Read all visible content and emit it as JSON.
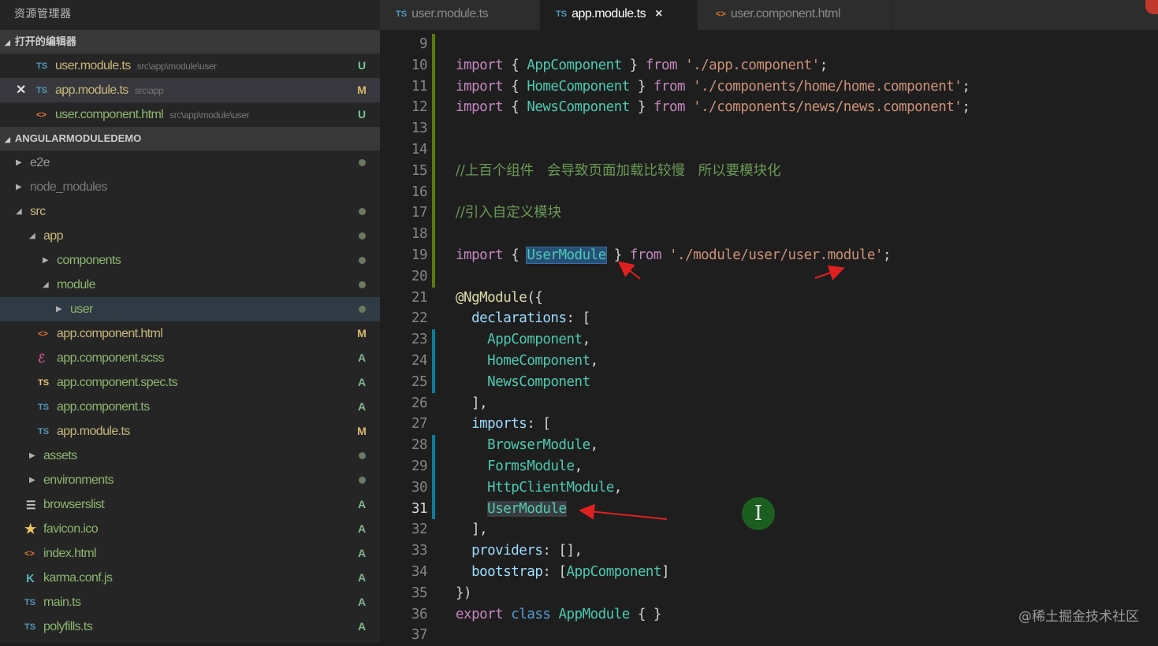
{
  "sidebar": {
    "title": "资源管理器",
    "open_editors": {
      "label": "打开的编辑器",
      "items": [
        {
          "icon": "TS",
          "name": "user.module.ts",
          "path": "src\\app\\module\\user",
          "status": "U"
        },
        {
          "icon": "TS",
          "name": "app.module.ts",
          "path": "src\\app",
          "status": "M"
        },
        {
          "icon": "<>",
          "name": "user.component.html",
          "path": "src\\app\\module\\user",
          "status": "U"
        }
      ]
    },
    "project": {
      "label": "ANGULARMODULEDEMO",
      "items": [
        {
          "name": "e2e"
        },
        {
          "name": "node_modules"
        },
        {
          "name": "src"
        },
        {
          "name": "app"
        },
        {
          "name": "components"
        },
        {
          "name": "module"
        },
        {
          "name": "user"
        },
        {
          "icon": "<>",
          "name": "app.component.html",
          "status": "M"
        },
        {
          "icon": "scss",
          "name": "app.component.scss",
          "status": "A"
        },
        {
          "icon": "TS",
          "name": "app.component.spec.ts",
          "status": "A"
        },
        {
          "icon": "TS",
          "name": "app.component.ts",
          "status": "A"
        },
        {
          "icon": "TS",
          "name": "app.module.ts",
          "status": "M"
        },
        {
          "name": "assets"
        },
        {
          "name": "environments"
        },
        {
          "icon": "lines-icon",
          "name": "browserslist",
          "status": "A"
        },
        {
          "icon": "star-icon",
          "name": "favicon.ico",
          "status": "A"
        },
        {
          "icon": "<>",
          "name": "index.html",
          "status": "A"
        },
        {
          "icon": "K",
          "name": "karma.conf.js",
          "status": "A"
        },
        {
          "icon": "TS",
          "name": "main.ts",
          "status": "A"
        },
        {
          "icon": "TS",
          "name": "polyfills.ts",
          "status": "A"
        }
      ]
    }
  },
  "tabs": [
    {
      "icon": "TS",
      "label": "user.module.ts"
    },
    {
      "icon": "TS",
      "label": "app.module.ts",
      "close": "×"
    },
    {
      "icon": "<>",
      "label": "user.component.html"
    }
  ],
  "editor": {
    "lines": [
      {
        "n": "9",
        "text": ""
      },
      {
        "n": "10",
        "text": "import { AppComponent } from './app.component';"
      },
      {
        "n": "11",
        "text": "import { HomeComponent } from './components/home/home.component';"
      },
      {
        "n": "12",
        "text": "import { NewsComponent } from './components/news/news.component';"
      },
      {
        "n": "13",
        "text": ""
      },
      {
        "n": "14",
        "text": ""
      },
      {
        "n": "15",
        "text": "//上百个组件   会导致页面加载比较慢   所以要模块化"
      },
      {
        "n": "16",
        "text": ""
      },
      {
        "n": "17",
        "text": "//引入自定义模块"
      },
      {
        "n": "18",
        "text": ""
      },
      {
        "n": "19",
        "text": "import { UserModule } from './module/user/user.module';"
      },
      {
        "n": "20",
        "text": ""
      },
      {
        "n": "21",
        "text": "@NgModule({"
      },
      {
        "n": "22",
        "text": "  declarations: ["
      },
      {
        "n": "23",
        "text": "    AppComponent,"
      },
      {
        "n": "24",
        "text": "    HomeComponent,"
      },
      {
        "n": "25",
        "text": "    NewsComponent"
      },
      {
        "n": "26",
        "text": "  ],"
      },
      {
        "n": "27",
        "text": "  imports: ["
      },
      {
        "n": "28",
        "text": "    BrowserModule,"
      },
      {
        "n": "29",
        "text": "    FormsModule,"
      },
      {
        "n": "30",
        "text": "    HttpClientModule,"
      },
      {
        "n": "31",
        "text": "    UserModule"
      },
      {
        "n": "32",
        "text": "  ],"
      },
      {
        "n": "33",
        "text": "  providers: [],"
      },
      {
        "n": "34",
        "text": "  bootstrap: [AppComponent]"
      },
      {
        "n": "35",
        "text": "})"
      },
      {
        "n": "36",
        "text": "export class AppModule { }"
      },
      {
        "n": "37",
        "text": ""
      }
    ]
  },
  "cursor_glyph": "I",
  "watermark": "@稀土掘金技术社区",
  "colors": {
    "accent_selection": "#264f78",
    "arrow": "#e02020",
    "status_modified": "#d7b96e",
    "status_untracked": "#73c991"
  }
}
